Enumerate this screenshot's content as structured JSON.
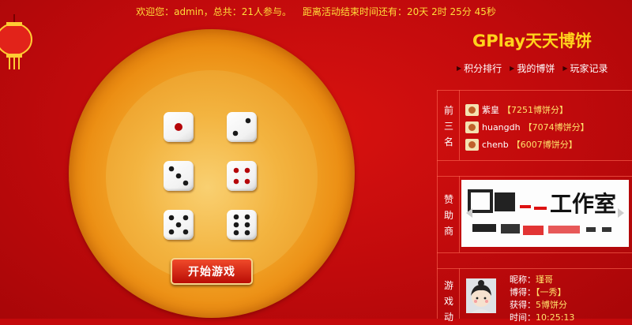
{
  "topbar": {
    "welcome": "欢迎您：admin，总共：21人参与。",
    "countdown_label": "距离活动结束时间还有：",
    "countdown_value": "20天 2时 25分 45秒"
  },
  "brand": {
    "title": "GPlay天天博饼"
  },
  "menu": [
    {
      "label": "积分排行"
    },
    {
      "label": "我的博饼"
    },
    {
      "label": "玩家记录"
    }
  ],
  "sections": {
    "top3": "前三名",
    "sponsor": "赞助商",
    "activity": "游戏动"
  },
  "top3": [
    {
      "name": "紫皇",
      "score": "【7251博饼分】"
    },
    {
      "name": "huangdh",
      "score": "【7074博饼分】"
    },
    {
      "name": "chenb",
      "score": "【6007博饼分】"
    }
  ],
  "sponsor": {
    "text": "工作室"
  },
  "game": {
    "start_label": "开始游戏",
    "dice": [
      1,
      2,
      3,
      4,
      5,
      6
    ],
    "colors": {
      "red_pip": "#b5060a",
      "black_pip": "#1a1a1a",
      "bowl": "#f3a92e"
    }
  },
  "player": {
    "nickname_label": "昵称：",
    "nickname": "瑾哥",
    "got_label": "博得：",
    "got": "【一秀】",
    "gain_label": "获得：",
    "gain": "5博饼分",
    "time_label": "时间：",
    "time": "10:25:13"
  }
}
